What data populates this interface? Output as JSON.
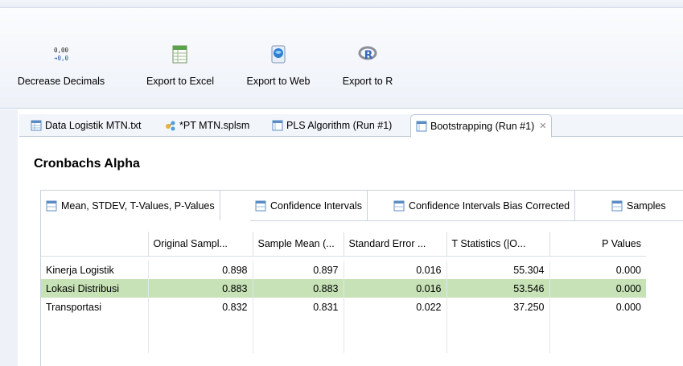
{
  "toolbar": {
    "buttons": [
      {
        "label": "Decrease Decimals",
        "icon": "decrease-decimals-icon",
        "icon_text_top": "0,00",
        "icon_text_bottom": "➔0,0"
      },
      {
        "label": "Export to Excel",
        "icon": "excel-icon"
      },
      {
        "label": "Export to Web",
        "icon": "web-icon"
      },
      {
        "label": "Export to R",
        "icon": "r-icon"
      }
    ]
  },
  "tabs": [
    {
      "label": "Data Logistik MTN.txt",
      "icon": "data-file-icon"
    },
    {
      "label": "*PT MTN.splsm",
      "icon": "model-icon"
    },
    {
      "label": "PLS Algorithm (Run #1)",
      "icon": "report-icon"
    },
    {
      "label": "Bootstrapping (Run #1)",
      "icon": "report-icon",
      "active": true,
      "close": "✕"
    }
  ],
  "section_title": "Cronbachs Alpha",
  "subtabs": [
    {
      "label": "Mean, STDEV, T-Values, P-Values",
      "active": true
    },
    {
      "label": "Confidence Intervals"
    },
    {
      "label": "Confidence Intervals Bias Corrected"
    },
    {
      "label": "Samples"
    }
  ],
  "table": {
    "columns": [
      "Original Sampl...",
      "Sample Mean (...",
      "Standard Error ...",
      "T Statistics (|O...",
      "P Values"
    ],
    "rows": [
      {
        "label": "Kinerja Logistik",
        "values": [
          "0.898",
          "0.897",
          "0.016",
          "55.304",
          "0.000"
        ]
      },
      {
        "label": "Lokasi Distribusi",
        "values": [
          "0.883",
          "0.883",
          "0.016",
          "53.546",
          "0.000"
        ],
        "highlighted": true
      },
      {
        "label": "Transportasi",
        "values": [
          "0.832",
          "0.831",
          "0.022",
          "37.250",
          "0.000"
        ]
      }
    ]
  },
  "colors": {
    "highlight": "#c6e2b6",
    "toolbar_bg": "#eef2f8",
    "border": "#c9d2de"
  }
}
